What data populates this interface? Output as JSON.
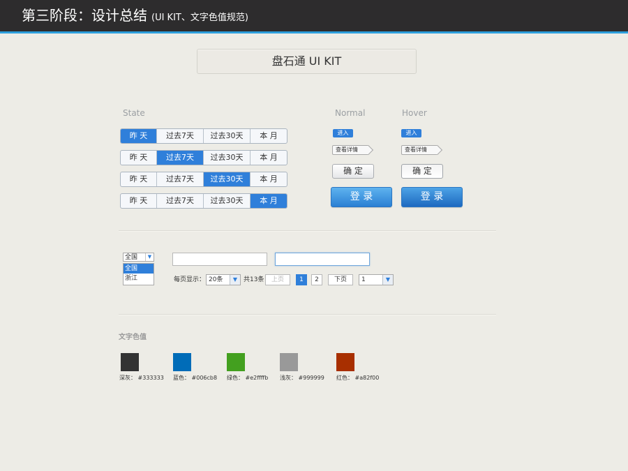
{
  "header": {
    "title": "第三阶段：设计总结",
    "subtitle": "(UI KIT、文字色值规范)"
  },
  "kit_title": "盘石通  UI KIT",
  "state": {
    "label": "State",
    "segments": [
      "昨 天",
      "过去7天",
      "过去30天",
      "本 月"
    ],
    "rows_active_index": [
      0,
      1,
      2,
      3
    ]
  },
  "buttons": {
    "normal_label": "Normal",
    "hover_label": "Hover",
    "enter": "进入",
    "detail": "查看详情",
    "confirm": "确 定",
    "login": "登 录"
  },
  "form": {
    "select_value": "全国",
    "select_options": [
      "全国",
      "浙江"
    ],
    "pager": {
      "per_page_label": "每页显示：",
      "per_page_value": "20条",
      "total": "共13条",
      "prev": "上页",
      "pages": [
        "1",
        "2"
      ],
      "next": "下页",
      "jump_value": "1"
    }
  },
  "text_colors": {
    "title": "文字色值",
    "items": [
      {
        "name": "深灰：",
        "value": "#333333",
        "hex": "#333333"
      },
      {
        "name": "蓝色：",
        "value": "#006cb8",
        "hex": "#006cb8"
      },
      {
        "name": "绿色：",
        "value": "#e2ffffb",
        "hex": "#43a01f"
      },
      {
        "name": "浅灰：",
        "value": "#999999",
        "hex": "#999999"
      },
      {
        "name": "红色：",
        "value": "#a82f00",
        "hex": "#a82f00"
      }
    ]
  }
}
